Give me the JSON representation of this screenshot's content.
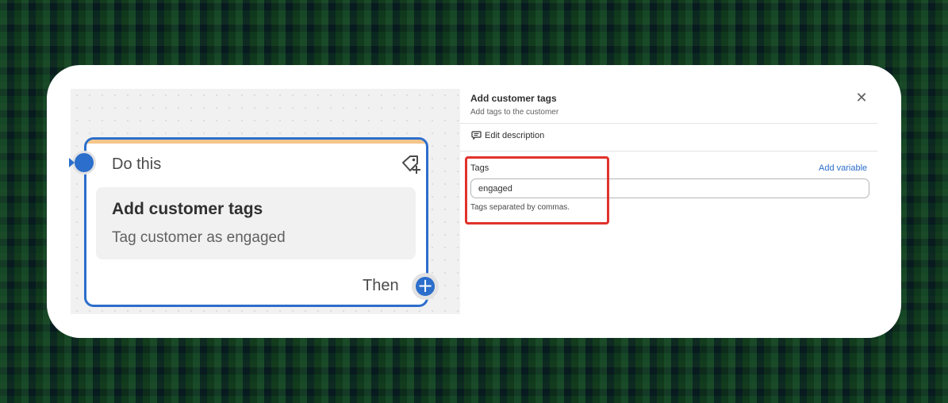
{
  "workflow_canvas": {
    "node": {
      "header_label": "Do this",
      "action_title": "Add customer tags",
      "action_summary": "Tag customer as engaged",
      "next_label": "Then",
      "icon": "tag-add-icon",
      "accent_color": "#f5c58c",
      "border_color": "#2c6ecb"
    }
  },
  "details_panel": {
    "title": "Add customer tags",
    "subtitle": "Add tags to the customer",
    "edit_description_label": "Edit description",
    "fields": {
      "tags": {
        "label": "Tags",
        "value": "engaged",
        "help_text": "Tags separated by commas.",
        "add_variable_label": "Add variable"
      }
    }
  },
  "colors": {
    "accent": "#2c6ecb",
    "highlight": "#e0322b"
  }
}
